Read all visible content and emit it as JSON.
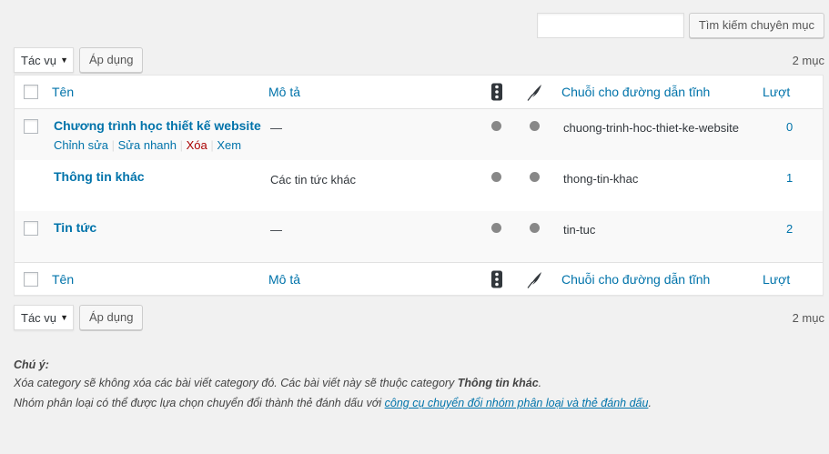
{
  "search": {
    "value": "",
    "placeholder": "",
    "button_label": "Tìm kiếm chuyên mục"
  },
  "bulk": {
    "selected": "Tác vụ",
    "apply_label": "Áp dụng",
    "count_text": "2 mục"
  },
  "columns": {
    "name": "Tên",
    "description": "Mô tả",
    "comments_icon": "traffic-light-icon",
    "posts_icon": "feather-icon",
    "slug": "Chuỗi cho đường dẫn tĩnh",
    "count": "Lượt"
  },
  "rows": [
    {
      "name": "Chương trình học thiết kế website",
      "description": "—",
      "slug": "chuong-trinh-hoc-thiet-ke-website",
      "count": "0",
      "actions": [
        "Chỉnh sửa",
        "Sửa nhanh",
        "Xóa",
        "Xem"
      ]
    },
    {
      "name": "Thông tin khác",
      "description": "Các tin tức khác",
      "slug": "thong-tin-khac",
      "count": "1"
    },
    {
      "name": "Tin tức",
      "description": "—",
      "slug": "tin-tuc",
      "count": "2"
    }
  ],
  "colors": {
    "link": "#0073aa",
    "danger": "#a00",
    "dot": "#888888"
  },
  "note": {
    "title": "Chú ý:",
    "line1_prefix": "Xóa category sẽ không xóa các bài viết category đó. Các bài viết này sẽ thuộc category ",
    "line1_bold": "Thông tin khác",
    "line1_suffix": ".",
    "line2_prefix": "Nhóm phân loại có thể được lựa chọn chuyển đổi thành thẻ đánh dấu với ",
    "line2_link": "công cụ chuyển đổi nhóm phân loại và thẻ đánh dấu",
    "line2_suffix": "."
  }
}
